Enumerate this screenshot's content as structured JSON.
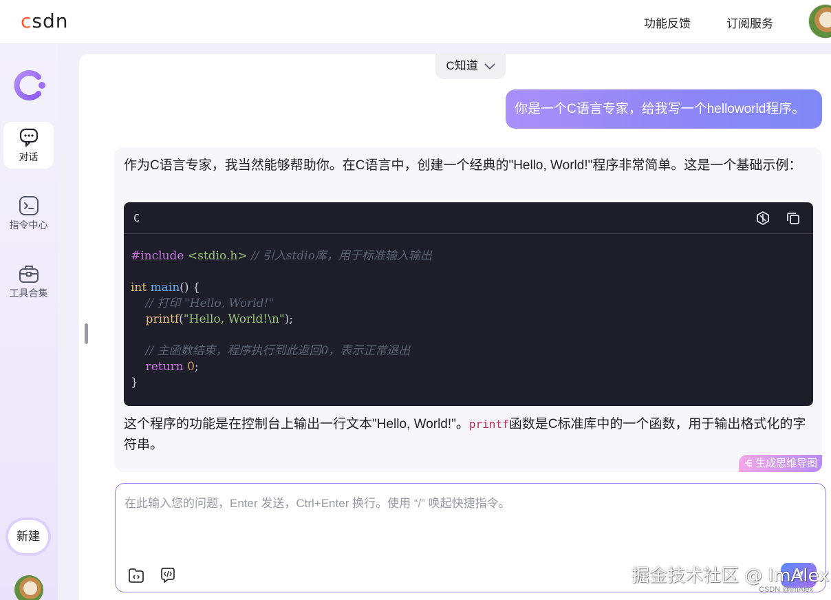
{
  "header": {
    "logo": "csdn",
    "nav": [
      "功能反馈",
      "订阅服务"
    ]
  },
  "sidebar": {
    "items": [
      {
        "label": "对话",
        "icon": "chat-icon",
        "active": true
      },
      {
        "label": "指令中心",
        "icon": "terminal-icon"
      },
      {
        "label": "工具合集",
        "icon": "toolbox-icon"
      }
    ],
    "new_label": "新建"
  },
  "model_selector": {
    "label": "C知道"
  },
  "conversation": {
    "user_message": "你是一个C语言专家，给我写一个helloworld程序。",
    "answer_intro": "作为C语言专家，我当然能够帮助你。在C语言中，创建一个经典的\"Hello, World!\"程序非常简单。这是一个基础示例：",
    "code": {
      "language": "C",
      "line1_include": "#include",
      "line1_header": "<stdio.h>",
      "line1_comment": "// 引入stdio库，用于标准输入输出",
      "line2_type": "int",
      "line2_fn": "main",
      "line2_rest": "() {",
      "line3_comment": "// 打印 \"Hello, World!\"",
      "line4_call": "printf",
      "line4_open": "(",
      "line4_str": "\"Hello, World!\\n\"",
      "line4_close": ");",
      "line5_comment": "// 主函数结束，程序执行到此返回0，表示正常退出",
      "line6_kw": "return",
      "line6_num": "0",
      "line6_end": ";",
      "line7": "}"
    },
    "answer_outro_1": "这个程序的功能是在控制台上输出一行文本\"Hello, World!\"。",
    "answer_outro_code": "printf",
    "answer_outro_2": "函数是C标准库中的一个函数，用于输出格式化的字符串。",
    "mindmap_label": "生成思维导图"
  },
  "input": {
    "placeholder": "在此输入您的问题，Enter 发送，Ctrl+Enter 换行。使用 “/” 唤起快捷指令。",
    "value": ""
  },
  "watermark": {
    "main": "掘金技术社区 @ ImAlex",
    "small": "CSDN @ImAlex"
  },
  "colors": {
    "accent": "#9b7df5",
    "brand_c": "#fc5531",
    "code_bg": "#1e1e2b"
  }
}
